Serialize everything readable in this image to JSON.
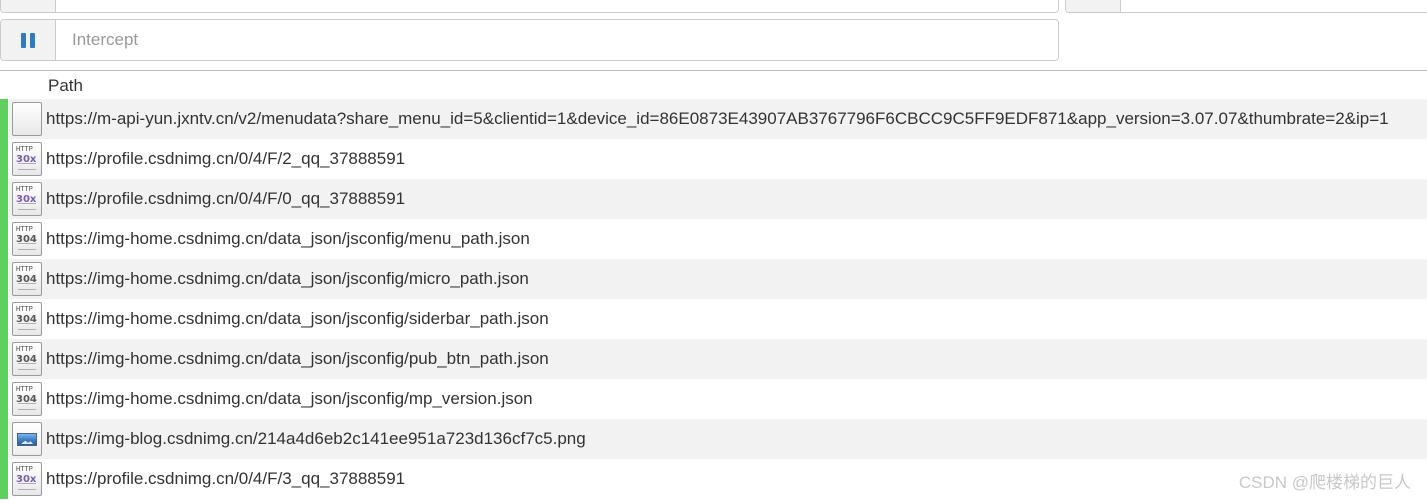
{
  "toolbar": {
    "intercept_placeholder": "Intercept"
  },
  "table": {
    "column_path": "Path",
    "rows": [
      {
        "status_icon": "blank-icon",
        "status_code": "",
        "url": "https://m-api-yun.jxntv.cn/v2/menudata?share_menu_id=5&clientid=1&device_id=86E0873E43907AB3767796F6CBCC9C5FF9EDF871&app_version=3.07.07&thumbrate=2&ip=1"
      },
      {
        "status_icon": "http-30x-icon",
        "status_code": "30x",
        "url": "https://profile.csdnimg.cn/0/4/F/2_qq_37888591"
      },
      {
        "status_icon": "http-30x-icon",
        "status_code": "30x",
        "url": "https://profile.csdnimg.cn/0/4/F/0_qq_37888591"
      },
      {
        "status_icon": "http-304-icon",
        "status_code": "304",
        "url": "https://img-home.csdnimg.cn/data_json/jsconfig/menu_path.json"
      },
      {
        "status_icon": "http-304-icon",
        "status_code": "304",
        "url": "https://img-home.csdnimg.cn/data_json/jsconfig/micro_path.json"
      },
      {
        "status_icon": "http-304-icon",
        "status_code": "304",
        "url": "https://img-home.csdnimg.cn/data_json/jsconfig/siderbar_path.json"
      },
      {
        "status_icon": "http-304-icon",
        "status_code": "304",
        "url": "https://img-home.csdnimg.cn/data_json/jsconfig/pub_btn_path.json"
      },
      {
        "status_icon": "http-304-icon",
        "status_code": "304",
        "url": "https://img-home.csdnimg.cn/data_json/jsconfig/mp_version.json"
      },
      {
        "status_icon": "image-icon",
        "status_code": "",
        "url": "https://img-blog.csdnimg.cn/214a4d6eb2c141ee951a723d136cf7c5.png"
      },
      {
        "status_icon": "http-30x-icon",
        "status_code": "30x",
        "url": "https://profile.csdnimg.cn/0/4/F/3_qq_37888591"
      }
    ]
  },
  "watermark": "CSDN @爬楼梯的巨人",
  "colors": {
    "flow_marker": "#5fcf5f",
    "pause_button": "#2f7bbf",
    "row_alt_bg": "#f2f2f2"
  }
}
